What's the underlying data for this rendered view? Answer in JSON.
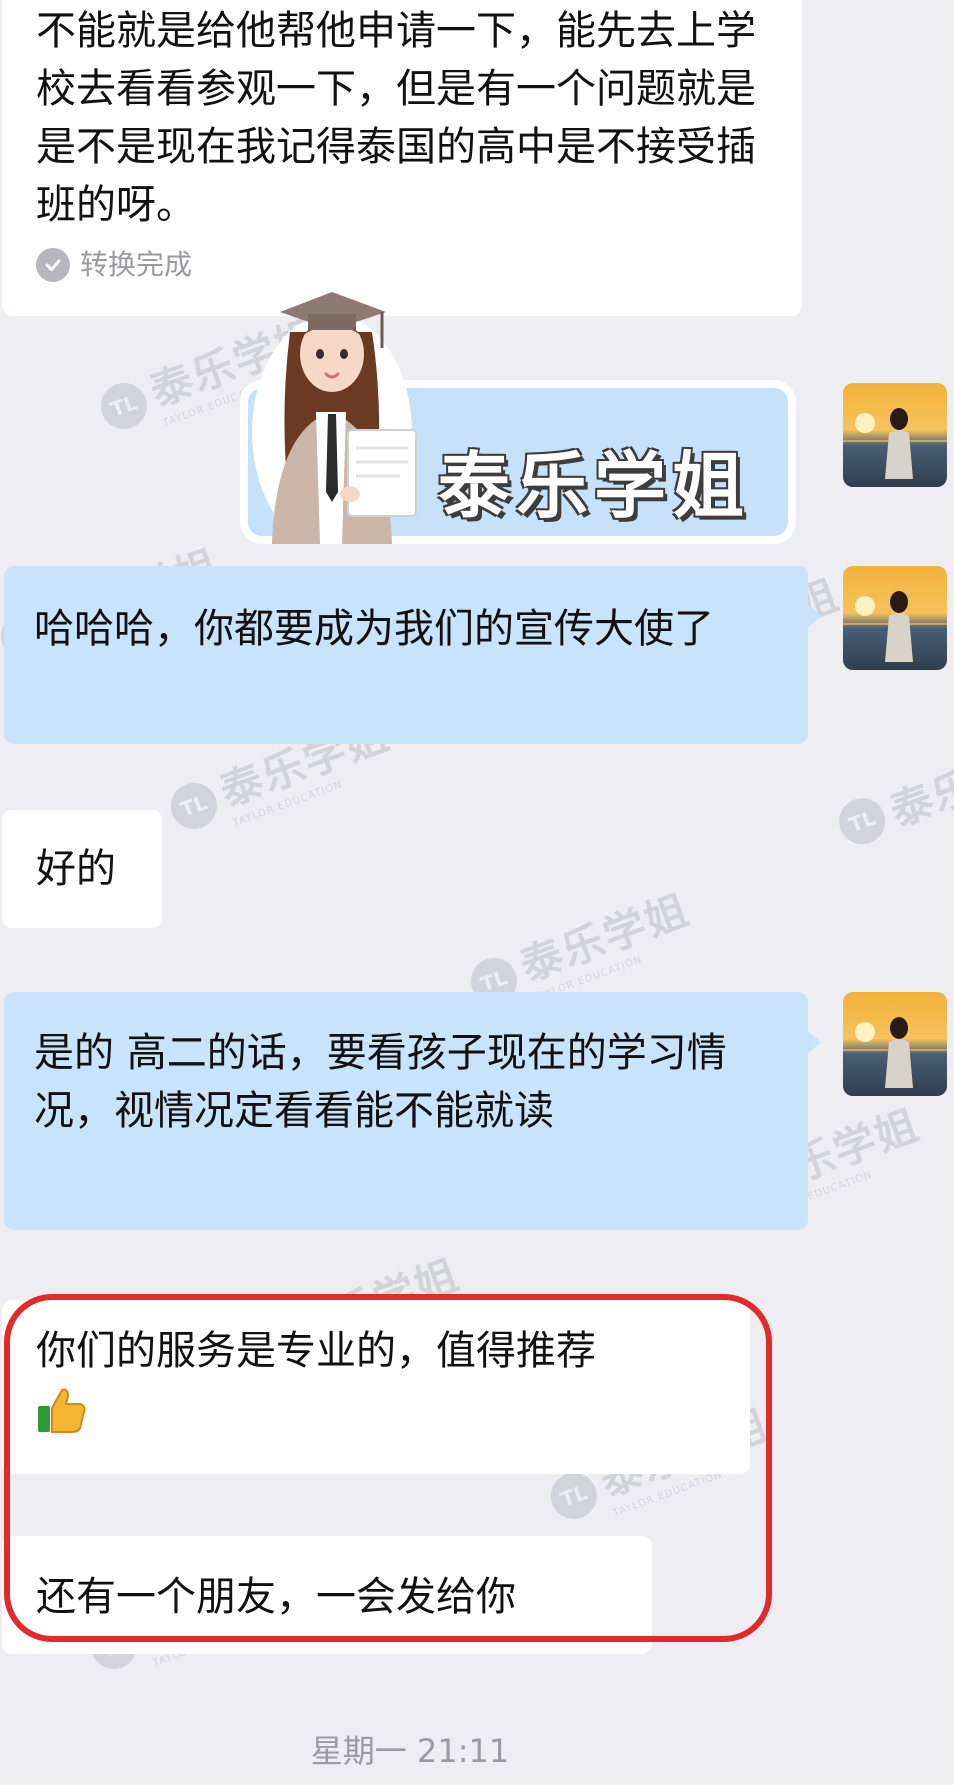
{
  "messages": [
    {
      "side": "left",
      "text": "不能就是给他帮他申请一下，能先去上学校去看看参观一下，但是有一个问题就是是不是现在我记得泰国的高中是不接受插班的呀。",
      "voice_status": "转换完成"
    },
    {
      "side": "right",
      "type": "sticker",
      "sticker_text": "泰乐学姐"
    },
    {
      "side": "right",
      "text": "哈哈哈，你都要成为我们的宣传大使了"
    },
    {
      "side": "left",
      "text": "好的"
    },
    {
      "side": "right",
      "text": "是的 高二的话，要看孩子现在的学习情况，视情况定看看能不能就读"
    },
    {
      "side": "left",
      "text": "你们的服务是专业的，值得推荐",
      "emoji": "thumbs-up"
    },
    {
      "side": "left",
      "text": "还有一个朋友，一会发给你"
    }
  ],
  "timestamp": "星期一 21:11",
  "colors": {
    "background": "#ededf2",
    "left_bubble": "#ffffff",
    "right_bubble": "#c9e3fb",
    "highlight": "#e22a2a"
  }
}
